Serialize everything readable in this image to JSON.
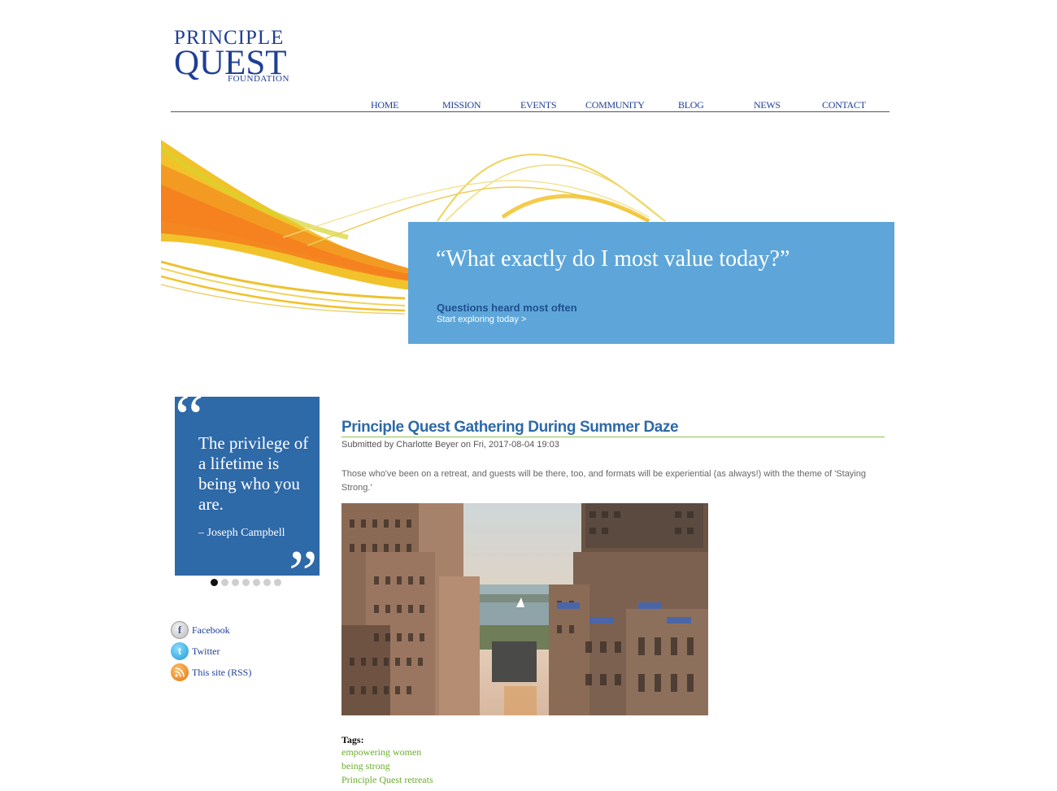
{
  "logo": {
    "line1": "PRINCIPLE",
    "line2": "QUEST",
    "line3": "FOUNDATION"
  },
  "nav": [
    "HOME",
    "MISSION",
    "EVENTS",
    "COMMUNITY",
    "BLOG",
    "NEWS",
    "CONTACT"
  ],
  "hero": {
    "quote": "“What exactly do I most value today?”",
    "subtitle": "Questions heard most often",
    "link": "Start exploring today  >"
  },
  "quote_slider": {
    "text": "The privilege of a lifetime is being who you are.",
    "author": "– Joseph Campbell",
    "dot_count": 7,
    "active_index": 0
  },
  "social": [
    {
      "label": "Facebook",
      "icon": "facebook-icon"
    },
    {
      "label": "Twitter",
      "icon": "twitter-icon"
    },
    {
      "label": "This site (RSS)",
      "icon": "rss-icon"
    }
  ],
  "article": {
    "title": "Principle Quest Gathering During Summer Daze",
    "submitted_prefix": "Submitted by ",
    "author": "Charlotte Beyer",
    "date_prefix": " on ",
    "date": "Fri, 2017-08-04 19:03",
    "body": "Those who've been on a retreat, and guests will be there, too, and formats will be experiential (as always!) with the theme of 'Staying Strong.'",
    "tags_label": "Tags:",
    "tags": [
      "empowering women",
      "being strong",
      "Principle Quest retreats"
    ]
  },
  "colors": {
    "brand_blue": "#1f3f94",
    "hero_blue": "#5ea6d9",
    "quote_blue": "#2e69a8",
    "tag_green": "#6aad2d"
  }
}
